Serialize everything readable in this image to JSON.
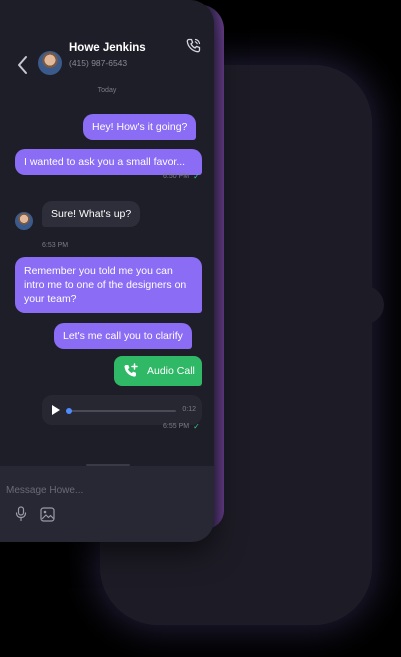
{
  "header": {
    "contact_name": "Howe Jenkins",
    "contact_phone": "(415) 987-6543",
    "back_icon": "chevron-left-icon",
    "call_icon": "phone-call-icon"
  },
  "chat": {
    "day_label": "Today",
    "messages": [
      {
        "text": "Hey! How's it going?"
      },
      {
        "text": "I wanted to ask you a small favor..."
      },
      {
        "text": "Sure! What's up?"
      },
      {
        "text": "Remember you told me you can intro me to one of the designers on your team?"
      },
      {
        "text": "Let's me call you to clarify"
      }
    ],
    "times": {
      "t1": "6:50 PM",
      "t2": "6:53 PM",
      "t3": "6:55 PM"
    },
    "audio_call_label": "Audio Call",
    "voice": {
      "duration": "0:12",
      "progress": 0.0
    }
  },
  "composer": {
    "placeholder": "Message Howe..."
  },
  "colors": {
    "outgoing_bubble": "#8b6cf5",
    "incoming_bubble": "#2e2e3a",
    "audio_call": "#2fb866",
    "read_check": "#37c98a"
  }
}
